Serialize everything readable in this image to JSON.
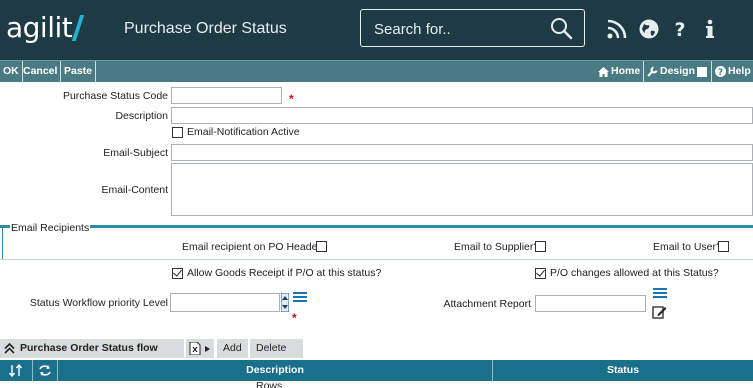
{
  "header": {
    "logo_text": "agilit",
    "title": "Purchase Order Status",
    "search_placeholder": "Search for..",
    "icons": [
      "rss-icon",
      "globe-icon",
      "help-icon",
      "info-icon"
    ]
  },
  "toolbar": {
    "ok": "OK",
    "cancel": "Cancel",
    "paste": "Paste",
    "home": "Home",
    "design": "Design",
    "help": "Help"
  },
  "form": {
    "status_code_label": "Purchase Status Code",
    "status_code_value": "",
    "description_label": "Description",
    "description_value": "",
    "email_notification_label": "Email-Notification Active",
    "email_notification_checked": false,
    "email_subject_label": "Email-Subject",
    "email_subject_value": "",
    "email_content_label": "Email-Content",
    "email_content_value": "",
    "required_marker": "*"
  },
  "recipients": {
    "legend": "Email Recipients",
    "po_header_label": "Email recipient on PO Header?",
    "po_header_checked": false,
    "supplier_label": "Email to Supplier?",
    "supplier_checked": false,
    "user_label": "Email to User?",
    "user_checked": false
  },
  "options": {
    "goods_receipt_label": "Allow Goods Receipt if P/O at this status?",
    "goods_receipt_checked": true,
    "po_changes_label": "P/O changes allowed at this Status?",
    "po_changes_checked": true,
    "workflow_label": "Status Workflow priority Level",
    "workflow_value": "",
    "attachment_label": "Attachment Report",
    "attachment_value": ""
  },
  "flow_control": {
    "title": "Purchase Order Status flow control",
    "add": "Add",
    "delete_rows": "Delete Selected Rows",
    "columns": [
      "Description",
      "Status"
    ]
  },
  "colors": {
    "header_bg": "#1e3a44",
    "toolbar_bg": "#4a7b84",
    "accent": "#2d8ba8",
    "grid_header_bg": "#1a6f8a",
    "required": "#cc1010"
  }
}
